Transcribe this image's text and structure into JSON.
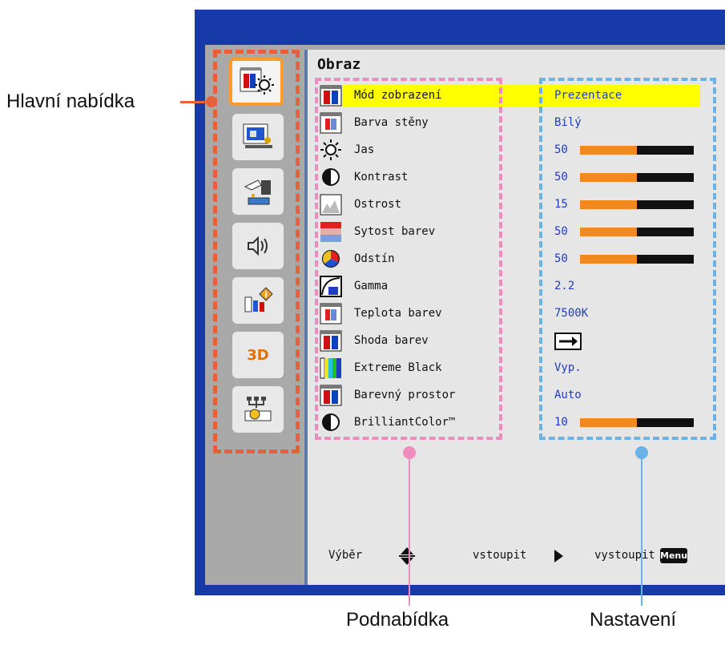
{
  "callouts": {
    "main_menu": "Hlavní nabídka",
    "submenu": "Podnabídka",
    "settings": "Nastavení"
  },
  "menu_title": "Obraz",
  "sidebar_icons": [
    {
      "name": "image-settings-icon",
      "selected": true
    },
    {
      "name": "display-settings-icon",
      "selected": false
    },
    {
      "name": "setup-icon",
      "selected": false
    },
    {
      "name": "volume-icon",
      "selected": false
    },
    {
      "name": "options-icon",
      "selected": false
    },
    {
      "name": "3d-icon",
      "label": "3D",
      "selected": false
    },
    {
      "name": "lan-icon",
      "selected": false
    }
  ],
  "rows": [
    {
      "label": "Mód zobrazení",
      "value": "Prezentace",
      "highlight": true,
      "icon": "display-mode-icon"
    },
    {
      "label": "Barva stěny",
      "value": "Bílý",
      "icon": "wall-color-icon"
    },
    {
      "label": "Jas",
      "value": "50",
      "bar": 0.5,
      "icon": "brightness-icon"
    },
    {
      "label": "Kontrast",
      "value": "50",
      "bar": 0.5,
      "icon": "contrast-icon"
    },
    {
      "label": "Ostrost",
      "value": "15",
      "bar": 0.5,
      "icon": "sharpness-icon"
    },
    {
      "label": "Sytost barev",
      "value": "50",
      "bar": 0.5,
      "icon": "saturation-icon"
    },
    {
      "label": "Odstín",
      "value": "50",
      "bar": 0.5,
      "icon": "hue-icon"
    },
    {
      "label": "Gamma",
      "value": "2.2",
      "icon": "gamma-icon"
    },
    {
      "label": "Teplota barev",
      "value": "7500K",
      "icon": "color-temp-icon"
    },
    {
      "label": "Shoda barev",
      "value": "",
      "arrow": true,
      "icon": "color-matching-icon"
    },
    {
      "label": "Extreme Black",
      "value": "Vyp.",
      "icon": "extreme-black-icon"
    },
    {
      "label": "Barevný prostor",
      "value": "Auto",
      "icon": "color-space-icon"
    },
    {
      "label": "BrilliantColor™",
      "value": "10",
      "bar": 0.5,
      "icon": "brilliantcolor-icon"
    }
  ],
  "footer": {
    "select": "Výběr",
    "enter": "vstoupit",
    "exit": "vystoupit",
    "menu_key": "Menu"
  },
  "colors": {
    "frame": "#163aa8",
    "highlight": "#ffff00",
    "value_text": "#1f3dbf",
    "bar_fill": "#f08a20",
    "main_callout": "#e8603a",
    "sub_callout": "#f08bbd",
    "set_callout": "#6ab3e8"
  }
}
